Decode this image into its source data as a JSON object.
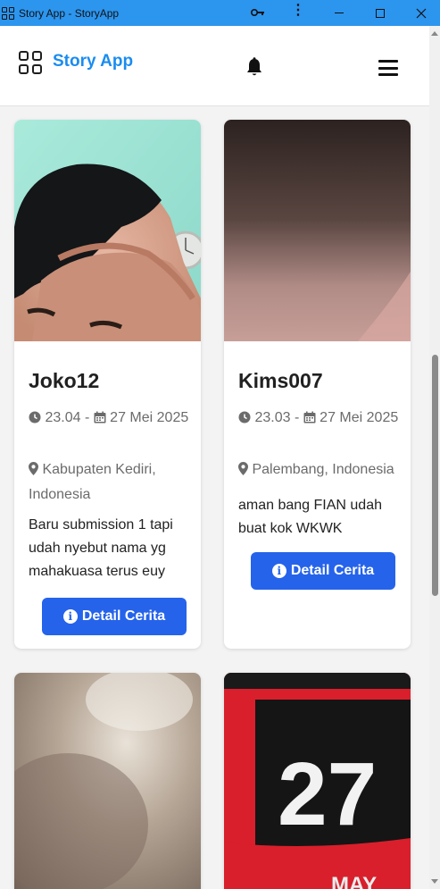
{
  "window": {
    "title": "Story App - StoryApp"
  },
  "navbar": {
    "brand": "Story App",
    "brand_color": "#1a8cf0",
    "icons": [
      "grid-icon",
      "bell-icon",
      "hamburger-icon"
    ]
  },
  "stories": [
    {
      "name": "Joko12",
      "time": "23.04",
      "date": "27 Mei 2025",
      "location": "Kabupaten Kediri, Indonesia",
      "description": "Baru submission 1 tapi udah nyebut nama yg mahakuasa terus euy",
      "button": "Detail Cerita"
    },
    {
      "name": "Kims007",
      "time": "23.03",
      "date": "27 Mei 2025",
      "location": "Palembang, Indonesia",
      "description": "aman bang FIAN udah buat kok WKWK",
      "button": "Detail Cerita"
    },
    {
      "image_alt": "blurred photo"
    },
    {
      "image_alt": "calendar photo",
      "calendar_day": "27",
      "calendar_month": "MAY"
    }
  ],
  "accent_button_color": "#2563eb"
}
